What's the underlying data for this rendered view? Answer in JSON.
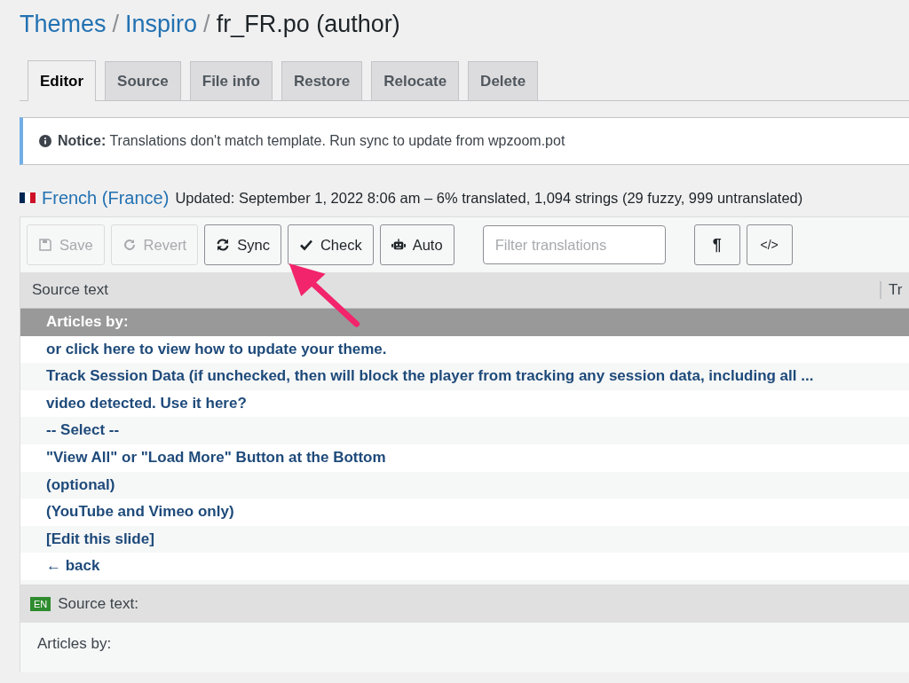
{
  "breadcrumb": [
    {
      "label": "Themes",
      "kind": "link"
    },
    {
      "label": "/",
      "kind": "separator"
    },
    {
      "label": "Inspiro",
      "kind": "link"
    },
    {
      "label": "/",
      "kind": "separator"
    },
    {
      "label": "fr_FR.po (author)",
      "kind": "current"
    }
  ],
  "tabs": [
    {
      "label": "Editor",
      "selected": true
    },
    {
      "label": "Source",
      "selected": false
    },
    {
      "label": "File info",
      "selected": false
    },
    {
      "label": "Restore",
      "selected": false
    },
    {
      "label": "Relocate",
      "selected": false
    },
    {
      "label": "Delete",
      "selected": false
    }
  ],
  "notice": {
    "label": "Notice:",
    "message": "Translations don't match template. Run sync to update from wpzoom.pot"
  },
  "locale": {
    "name": "French (France)",
    "stats": "Updated: September 1, 2022 8:06 am – 6% translated, 1,094 strings (29 fuzzy, 999 untranslated)"
  },
  "toolbar": [
    {
      "label": "Save",
      "kind": "save",
      "disabled": true
    },
    {
      "label": "Revert",
      "kind": "revert",
      "disabled": true
    },
    {
      "label": "Sync",
      "kind": "sync",
      "disabled": false
    },
    {
      "label": "Check",
      "kind": "check",
      "disabled": false
    },
    {
      "label": "Auto",
      "kind": "auto",
      "disabled": false
    }
  ],
  "filter": {
    "placeholder": "Filter translations"
  },
  "view_buttons": [
    {
      "kind": "pilcrow",
      "label": "¶"
    },
    {
      "kind": "code",
      "label": "</>"
    }
  ],
  "table": {
    "columns": [
      "Source text",
      "Tr"
    ],
    "rows": [
      {
        "text": "Articles by:",
        "selected": true
      },
      {
        "text": "or click here to view how to update your theme.",
        "selected": false
      },
      {
        "text": "Track Session Data (if unchecked, then will block the player from tracking any session data, including all ...",
        "selected": false
      },
      {
        "text": "video detected. Use it here?",
        "selected": false
      },
      {
        "text": "-- Select --",
        "selected": false
      },
      {
        "text": "\"View All\" or \"Load More\" Button at the Bottom",
        "selected": false
      },
      {
        "text": "(optional)",
        "selected": false
      },
      {
        "text": "(YouTube and Vimeo only)",
        "selected": false
      },
      {
        "text": "[Edit this slide]",
        "selected": false
      },
      {
        "text": "← back",
        "selected": false
      }
    ]
  },
  "source_pane": {
    "badge": "EN",
    "label": "Source text:",
    "text": "Articles by:"
  }
}
